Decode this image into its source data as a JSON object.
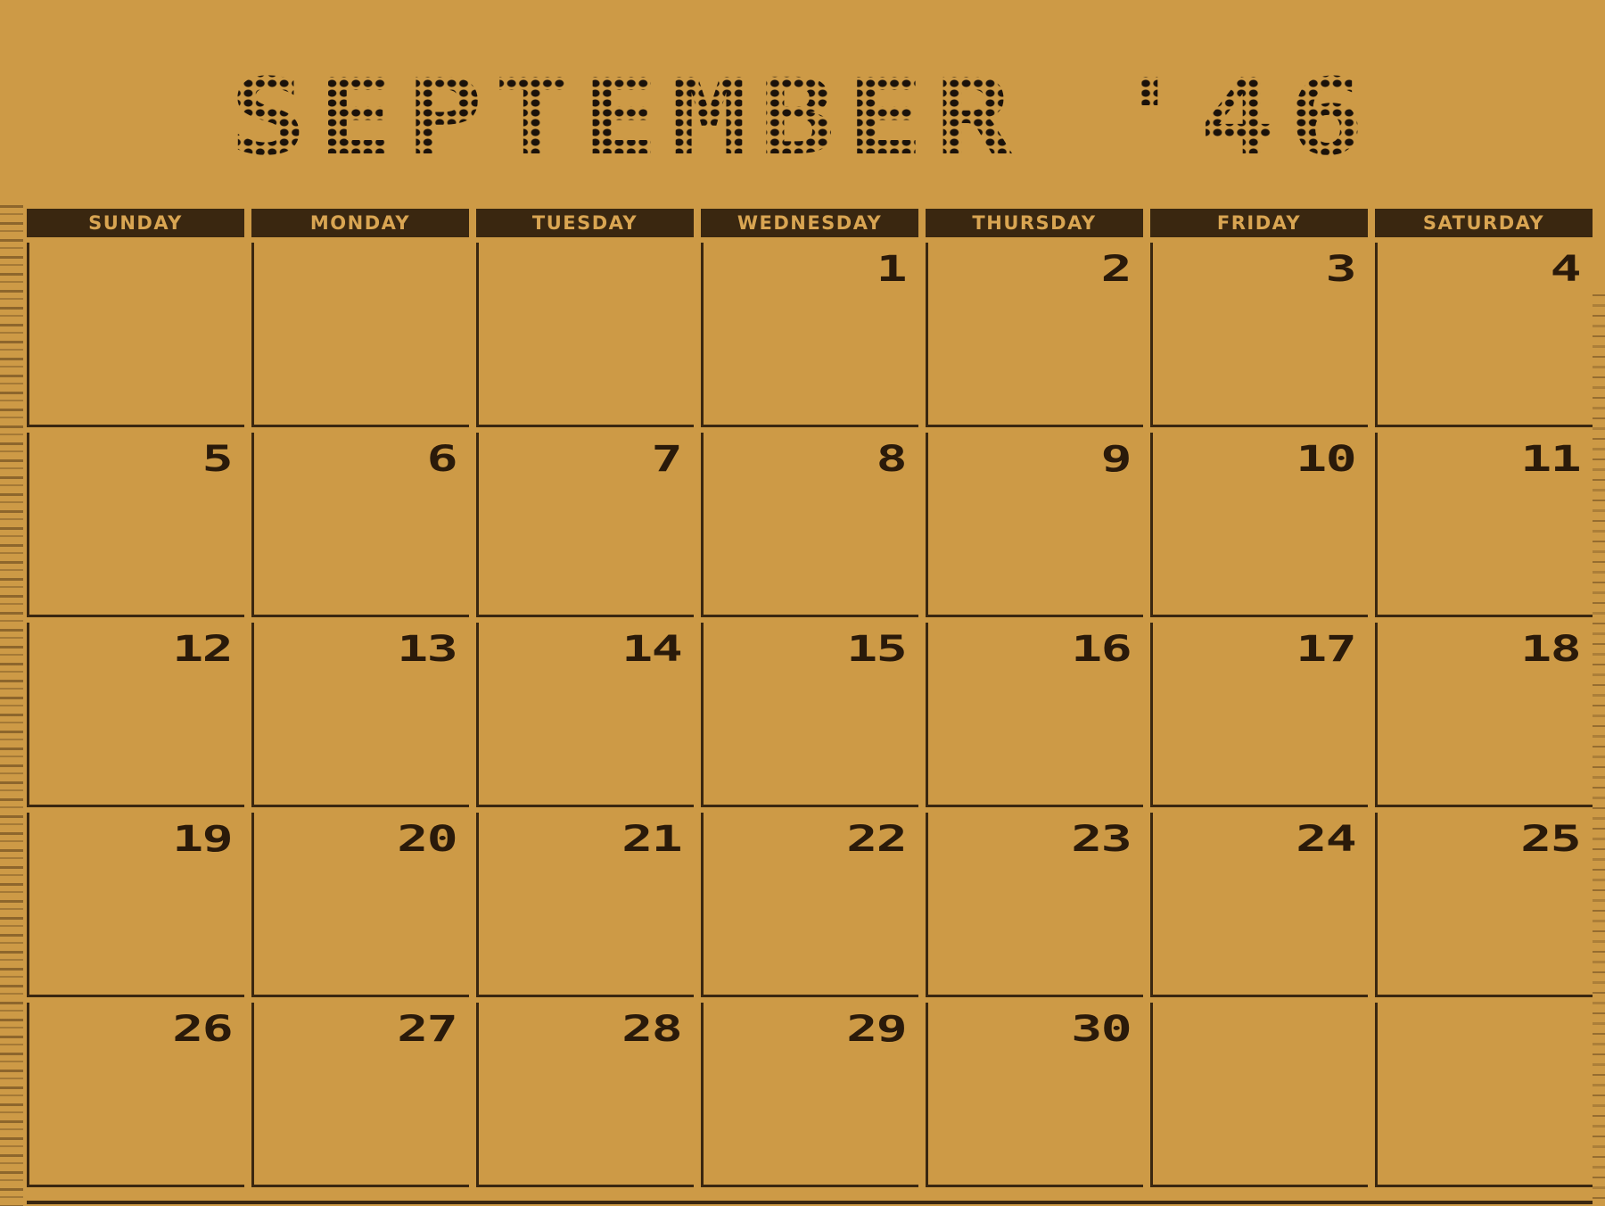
{
  "calendar": {
    "title": "SEPTEMBER '46",
    "weekdays": [
      "SUNDAY",
      "MONDAY",
      "TUESDAY",
      "WEDNESDAY",
      "THURSDAY",
      "FRIDAY",
      "SATURDAY"
    ],
    "weeks": [
      [
        "",
        "",
        "",
        "1",
        "2",
        "3",
        "4"
      ],
      [
        "5",
        "6",
        "7",
        "8",
        "9",
        "10",
        "11"
      ],
      [
        "12",
        "13",
        "14",
        "15",
        "16",
        "17",
        "18"
      ],
      [
        "19",
        "20",
        "21",
        "22",
        "23",
        "24",
        "25"
      ],
      [
        "26",
        "27",
        "28",
        "29",
        "30",
        "",
        ""
      ]
    ]
  },
  "colors": {
    "paper": "#cd9a46",
    "ink": "#3a2710",
    "header_text": "#d9a552"
  }
}
